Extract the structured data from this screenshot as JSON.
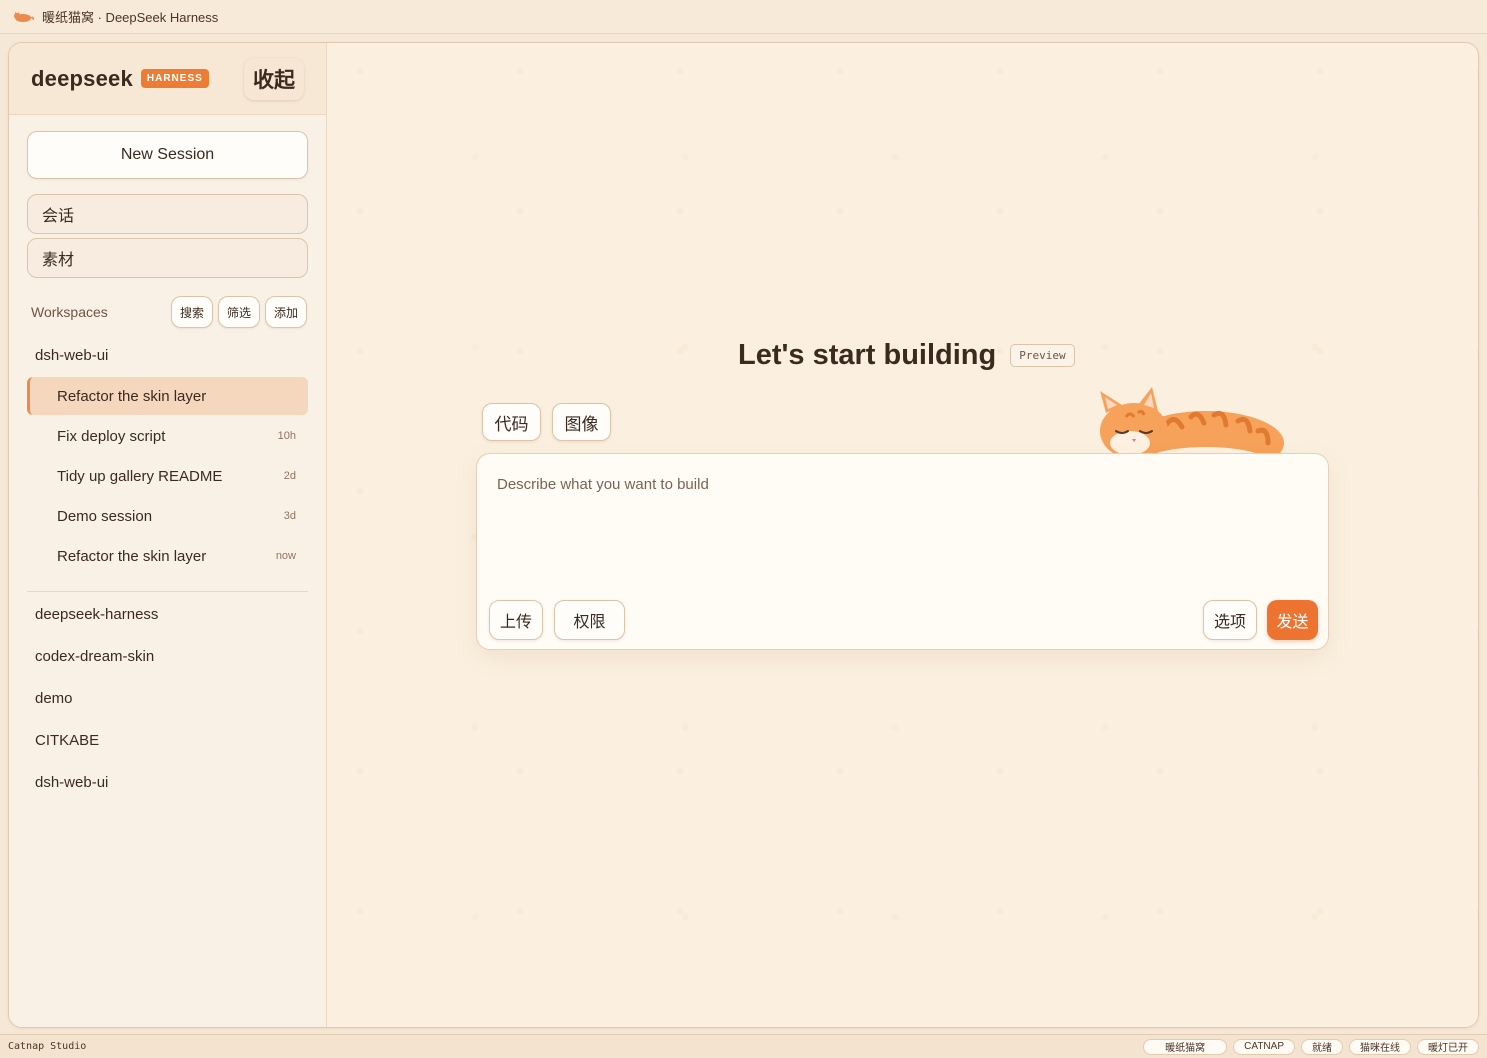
{
  "window": {
    "title": "暖纸猫窝 · DeepSeek Harness"
  },
  "sidebar": {
    "brand": "deepseek",
    "badge": "HARNESS",
    "collapse_label": "收起",
    "new_session_label": "New Session",
    "nav": [
      {
        "label": "会话"
      },
      {
        "label": "素材"
      }
    ],
    "workspaces_label": "Workspaces",
    "workspace_actions": [
      {
        "label": "搜索"
      },
      {
        "label": "筛选"
      },
      {
        "label": "添加"
      }
    ],
    "active_workspace": "dsh-web-ui",
    "sessions": [
      {
        "title": "Refactor the skin layer",
        "age": ""
      },
      {
        "title": "Fix deploy script",
        "age": "10h"
      },
      {
        "title": "Tidy up gallery README",
        "age": "2d"
      },
      {
        "title": "Demo session",
        "age": "3d"
      },
      {
        "title": "Refactor the skin layer",
        "age": "now"
      }
    ],
    "other_workspaces": [
      "deepseek-harness",
      "codex-dream-skin",
      "demo",
      "CITKABE",
      "dsh-web-ui"
    ]
  },
  "main": {
    "headline": "Let's start building",
    "preview_tag": "Preview",
    "modes": [
      {
        "label": "代码"
      },
      {
        "label": "图像"
      }
    ],
    "composer": {
      "placeholder": "Describe what you want to build",
      "upload_label": "上传",
      "permissions_label": "权限",
      "options_label": "选项",
      "send_label": "发送"
    }
  },
  "statusbar": {
    "left": "Catnap Studio",
    "pills": [
      "暖纸猫窝",
      "CATNAP",
      "就绪",
      "猫咪在线",
      "暖灯已开"
    ]
  },
  "colors": {
    "accent": "#ec7430",
    "background": "#fbf0df",
    "sidebar": "#faf1e6",
    "active_item": "#f5d7bd"
  },
  "icons": {
    "app": "cat-icon",
    "mascot": "sleeping-cat"
  }
}
